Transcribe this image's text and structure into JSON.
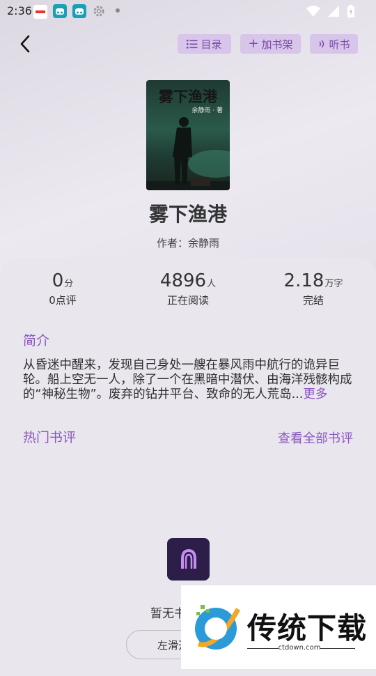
{
  "status_bar": {
    "time": "2:36"
  },
  "topbar": {
    "buttons": [
      {
        "label": "目录",
        "icon": "list-icon"
      },
      {
        "label": "加书架",
        "icon": "plus-icon"
      },
      {
        "label": "听书",
        "icon": "audio-icon"
      }
    ]
  },
  "book": {
    "cover_title": "雾下渔港",
    "cover_author": "余静雨 · 著",
    "title": "雾下渔港",
    "author": "作者：余静雨"
  },
  "stats": [
    {
      "value": "0",
      "unit": "分",
      "label": "0点评"
    },
    {
      "value": "4896",
      "unit": "人",
      "label": "正在阅读"
    },
    {
      "value": "2.18",
      "unit": "万字",
      "label": "完结"
    }
  ],
  "intro": {
    "heading": "简介",
    "text": "从昏迷中醒来，发现自己身处一艘在暴风雨中航行的诡异巨轮。船上空无一人，除了一个在黑暗中潜伏、由海洋残骸构成的“神秘生物”。废弃的钻井平台、致命的无人荒岛...",
    "more": "更多"
  },
  "reviews": {
    "heading": "热门书评",
    "view_all": "查看全部书评",
    "empty_text": "暂无书",
    "swipe_button": "左滑开"
  },
  "watermark": {
    "text": "传统下载",
    "url": "ctdown.com"
  },
  "colors": {
    "accent": "#8b58c0",
    "pill_bg": "#d8c5ea",
    "logo_bg": "#2c1e49"
  }
}
